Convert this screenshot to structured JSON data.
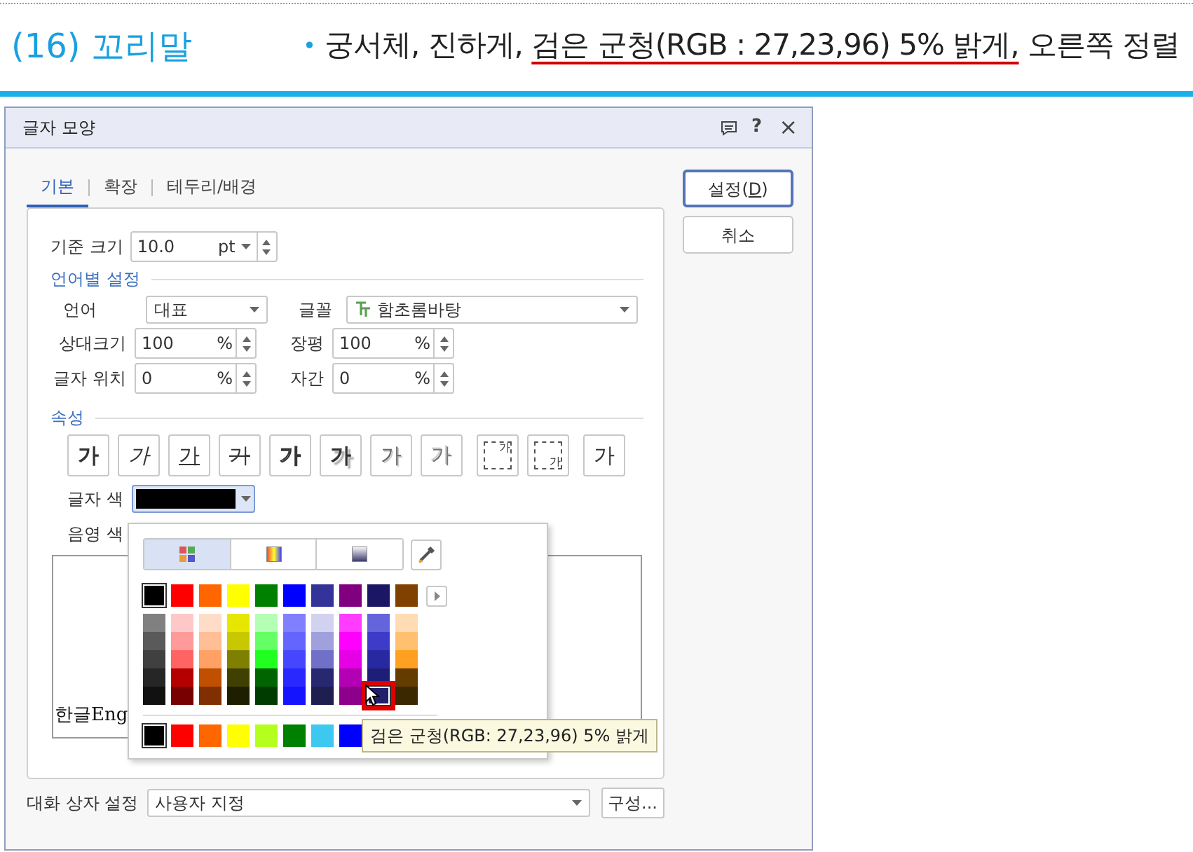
{
  "heading": {
    "title": "(16) 꼬리말",
    "bullet": "•",
    "parts": [
      {
        "text": "궁서체, 진하게, ",
        "underlined": false
      },
      {
        "text": "검은 군청(RGB : 27,23,96) 5% 밝게,",
        "underlined": true
      },
      {
        "text": " 오른쪽 정렬",
        "underlined": false
      }
    ]
  },
  "window": {
    "title": "글자 모양",
    "help": "?",
    "close": "×"
  },
  "tabs": [
    {
      "label": "기본",
      "selected": true
    },
    {
      "label": "확장",
      "selected": false
    },
    {
      "label": "테두리/배경",
      "selected": false
    }
  ],
  "buttons": [
    {
      "label": "설정(",
      "mnemonic": "D",
      "suffix": ")",
      "default": true
    },
    {
      "label": "취소",
      "default": false
    }
  ],
  "base_size": {
    "label": "기준 크기",
    "value": "10.0",
    "unit": "pt"
  },
  "language_section": {
    "title": "언어별 설정",
    "language_label": "언어",
    "language": "대표",
    "font_label": "글꼴",
    "font": "함초롬바탕",
    "fields": [
      {
        "label": "상대크기",
        "value": "100",
        "unit": "%"
      },
      {
        "label": "장평",
        "value": "100",
        "unit": "%"
      },
      {
        "label": "글자 위치",
        "value": "0",
        "unit": "%"
      },
      {
        "label": "자간",
        "value": "0",
        "unit": "%"
      }
    ]
  },
  "attributes_section": {
    "title": "속성",
    "buttons": [
      {
        "label": "가",
        "kind": "bold"
      },
      {
        "label": "가",
        "kind": "italic"
      },
      {
        "label": "가",
        "kind": "underline"
      },
      {
        "label": "가",
        "kind": "strike"
      },
      {
        "label": "가",
        "kind": "outline"
      },
      {
        "label": "가",
        "kind": "shadow"
      },
      {
        "label": "가",
        "kind": "emboss"
      },
      {
        "label": "가",
        "kind": "engrave"
      },
      {
        "label": "가",
        "kind": "superscript"
      },
      {
        "label": "가",
        "kind": "subscript"
      },
      {
        "label": "가",
        "kind": "normal"
      }
    ]
  },
  "text_color": {
    "label": "글자 색",
    "color": "#000000"
  },
  "shade_color": {
    "label": "음영 색"
  },
  "preview": {
    "text": "한글Eng"
  },
  "palette": {
    "tabs": [
      {
        "kind": "grid",
        "selected": true
      },
      {
        "kind": "spectrum",
        "selected": false
      },
      {
        "kind": "gradient",
        "selected": false
      }
    ],
    "standard": [
      {
        "color": "#000000",
        "selected": true
      },
      {
        "color": "#ff0000",
        "selected": false
      },
      {
        "color": "#ff6600",
        "selected": false
      },
      {
        "color": "#ffff00",
        "selected": false
      },
      {
        "color": "#008000",
        "selected": false
      },
      {
        "color": "#0000ff",
        "selected": false
      },
      {
        "color": "#333399",
        "selected": false
      },
      {
        "color": "#800080",
        "selected": false
      },
      {
        "color": "#1b1764",
        "selected": false
      },
      {
        "color": "#804000",
        "selected": false
      }
    ],
    "shades": [
      {
        "cells": [
          {
            "color": "#808080",
            "selected": false
          },
          {
            "color": "#5a5a5a",
            "selected": false
          },
          {
            "color": "#404040",
            "selected": false
          },
          {
            "color": "#262626",
            "selected": false
          },
          {
            "color": "#111111",
            "selected": false
          }
        ]
      },
      {
        "cells": [
          {
            "color": "#ffc8c8",
            "selected": false
          },
          {
            "color": "#ff9a9a",
            "selected": false
          },
          {
            "color": "#ff6464",
            "selected": false
          },
          {
            "color": "#b40000",
            "selected": false
          },
          {
            "color": "#780000",
            "selected": false
          }
        ]
      },
      {
        "cells": [
          {
            "color": "#ffdcc8",
            "selected": false
          },
          {
            "color": "#ffbe96",
            "selected": false
          },
          {
            "color": "#ffa064",
            "selected": false
          },
          {
            "color": "#c05000",
            "selected": false
          },
          {
            "color": "#803000",
            "selected": false
          }
        ]
      },
      {
        "cells": [
          {
            "color": "#e6e600",
            "selected": false
          },
          {
            "color": "#c8c800",
            "selected": false
          },
          {
            "color": "#808000",
            "selected": false
          },
          {
            "color": "#404000",
            "selected": false
          },
          {
            "color": "#1e1e00",
            "selected": false
          }
        ]
      },
      {
        "cells": [
          {
            "color": "#b4ffb4",
            "selected": false
          },
          {
            "color": "#64ff64",
            "selected": false
          },
          {
            "color": "#20ff20",
            "selected": false
          },
          {
            "color": "#006400",
            "selected": false
          },
          {
            "color": "#003c00",
            "selected": false
          }
        ]
      },
      {
        "cells": [
          {
            "color": "#8080ff",
            "selected": false
          },
          {
            "color": "#6464ff",
            "selected": false
          },
          {
            "color": "#4646ff",
            "selected": false
          },
          {
            "color": "#2828ff",
            "selected": false
          },
          {
            "color": "#1414ff",
            "selected": false
          }
        ]
      },
      {
        "cells": [
          {
            "color": "#d2d2f0",
            "selected": false
          },
          {
            "color": "#a0a0dc",
            "selected": false
          },
          {
            "color": "#7070c8",
            "selected": false
          },
          {
            "color": "#282870",
            "selected": false
          },
          {
            "color": "#1e1e50",
            "selected": false
          }
        ]
      },
      {
        "cells": [
          {
            "color": "#ff3cff",
            "selected": false
          },
          {
            "color": "#ff00ff",
            "selected": false
          },
          {
            "color": "#e600e6",
            "selected": false
          },
          {
            "color": "#b400b4",
            "selected": false
          },
          {
            "color": "#8c008c",
            "selected": false
          }
        ]
      },
      {
        "cells": [
          {
            "color": "#6464dc",
            "selected": false
          },
          {
            "color": "#3c3cc8",
            "selected": false
          },
          {
            "color": "#2828a0",
            "selected": false
          },
          {
            "color": "#1e1e78",
            "selected": false
          },
          {
            "color": "#221e6e",
            "selected": true
          }
        ]
      },
      {
        "cells": [
          {
            "color": "#ffdcb4",
            "selected": false
          },
          {
            "color": "#ffc070",
            "selected": false
          },
          {
            "color": "#ffa020",
            "selected": false
          },
          {
            "color": "#643c00",
            "selected": false
          },
          {
            "color": "#3c2800",
            "selected": false
          }
        ]
      }
    ],
    "recent": [
      {
        "color": "#000000",
        "selected": true
      },
      {
        "color": "#ff0000",
        "selected": false
      },
      {
        "color": "#ff6600",
        "selected": false
      },
      {
        "color": "#ffff00",
        "selected": false
      },
      {
        "color": "#b4ff1e",
        "selected": false
      },
      {
        "color": "#008000",
        "selected": false
      },
      {
        "color": "#3cc8f0",
        "selected": false
      },
      {
        "color": "#0000ff",
        "selected": false
      }
    ],
    "tooltip": "검은 군청(RGB: 27,23,96) 5% 밝게"
  },
  "dialog_setting": {
    "label": "대화 상자 설정",
    "value": "사용자 지정",
    "button": "구성..."
  }
}
